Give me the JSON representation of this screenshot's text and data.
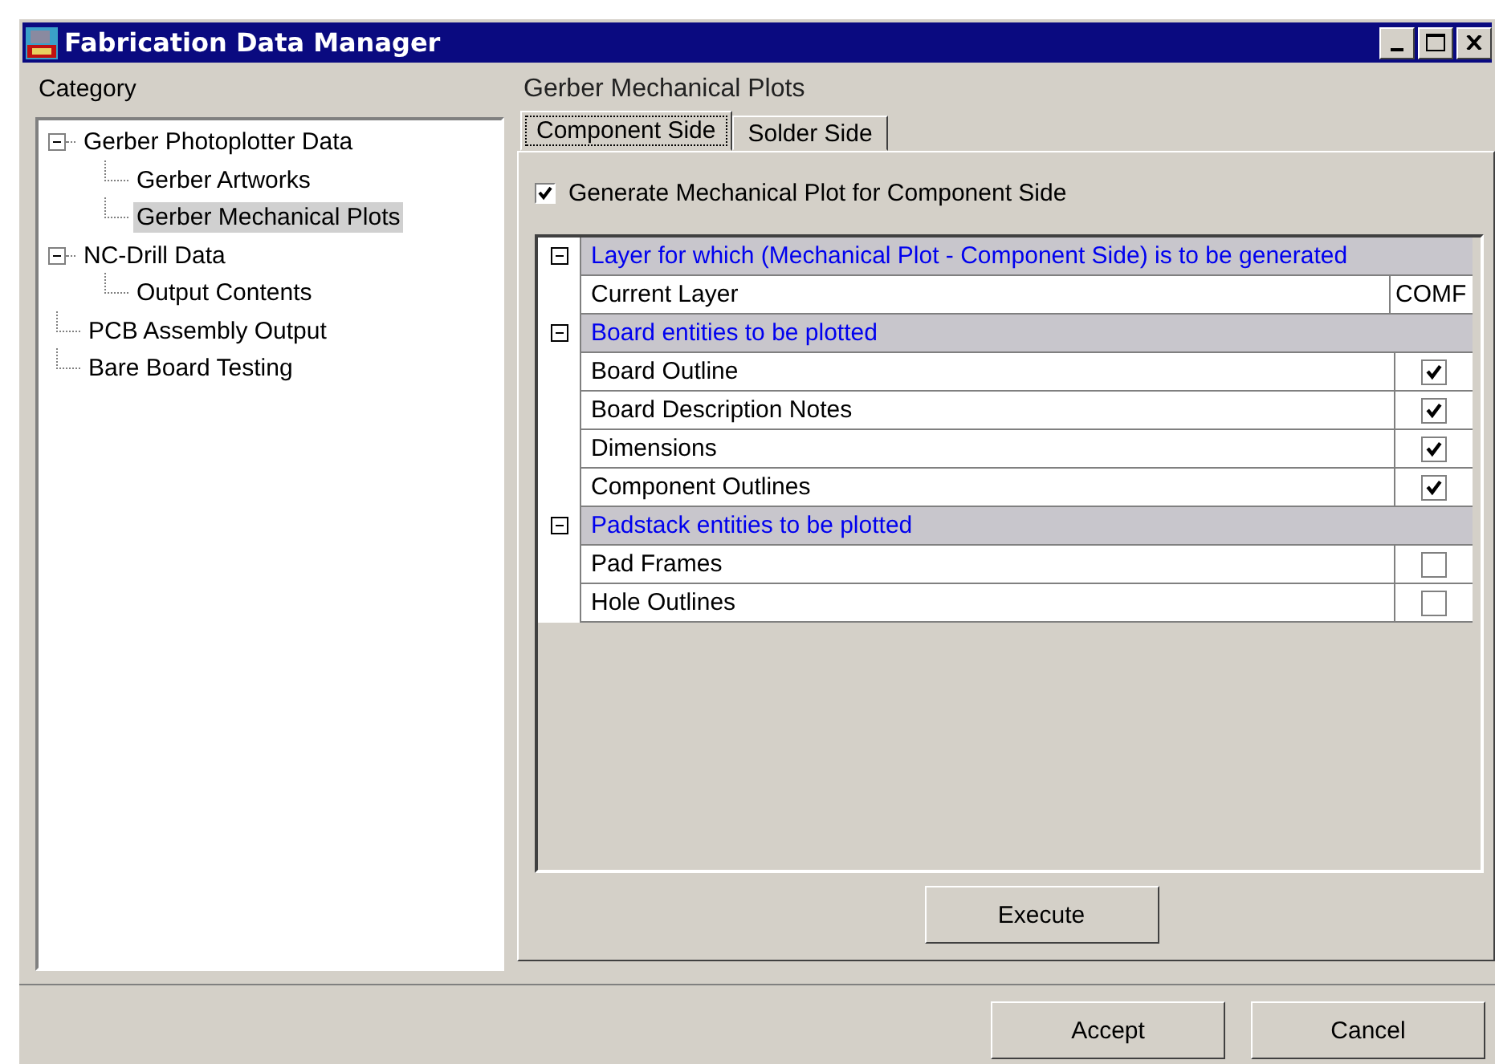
{
  "window": {
    "title": "Fabrication Data Manager"
  },
  "category": {
    "label": "Category",
    "tree": [
      {
        "label": "Gerber Photoplotter Data",
        "expanded": true,
        "selected": false,
        "children": [
          {
            "label": "Gerber Artworks",
            "selected": false
          },
          {
            "label": "Gerber Mechanical Plots",
            "selected": true
          }
        ]
      },
      {
        "label": "NC-Drill Data",
        "expanded": true,
        "selected": false,
        "children": [
          {
            "label": "Output Contents",
            "selected": false
          }
        ]
      },
      {
        "label": "PCB Assembly Output",
        "selected": false
      },
      {
        "label": "Bare Board Testing",
        "selected": false
      }
    ]
  },
  "panel": {
    "title": "Gerber Mechanical Plots",
    "tabs": [
      {
        "label": "Component Side",
        "selected": true
      },
      {
        "label": "Solder Side",
        "selected": false
      }
    ],
    "generate": {
      "label": "Generate Mechanical Plot for Component Side",
      "checked": true
    },
    "grid": [
      {
        "header": "Layer for which (Mechanical Plot - Component Side) is to be generated",
        "expanded": true,
        "rows": [
          {
            "kind": "text",
            "label": "Current Layer",
            "value": "COMF"
          }
        ]
      },
      {
        "header": "Board entities to be plotted",
        "expanded": true,
        "rows": [
          {
            "kind": "check",
            "label": "Board Outline",
            "checked": true
          },
          {
            "kind": "check",
            "label": "Board Description Notes",
            "checked": true
          },
          {
            "kind": "check",
            "label": "Dimensions",
            "checked": true
          },
          {
            "kind": "check",
            "label": "Component Outlines",
            "checked": true
          }
        ]
      },
      {
        "header": "Padstack entities to be plotted",
        "expanded": true,
        "rows": [
          {
            "kind": "check",
            "label": "Pad Frames",
            "checked": false
          },
          {
            "kind": "check",
            "label": "Hole Outlines",
            "checked": false
          }
        ]
      }
    ],
    "execute": "Execute"
  },
  "buttons": [
    "Accept",
    "Cancel"
  ]
}
